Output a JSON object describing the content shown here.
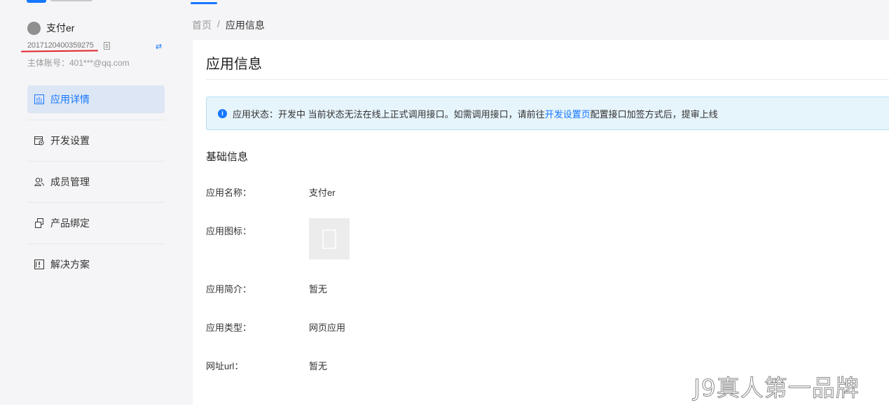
{
  "app": {
    "name": "支付er",
    "id": "2017120400359275",
    "owner": "主体账号：401***@qq.com"
  },
  "menu": [
    {
      "label": "应用详情",
      "icon": "chart-icon",
      "active": true
    },
    {
      "label": "开发设置",
      "icon": "settings-doc-icon",
      "active": false
    },
    {
      "label": "成员管理",
      "icon": "users-icon",
      "active": false
    },
    {
      "label": "产品绑定",
      "icon": "link-icon",
      "active": false
    },
    {
      "label": "解决方案",
      "icon": "solution-icon",
      "active": false
    }
  ],
  "breadcrumb": {
    "home": "首页",
    "separator": "/",
    "current": "应用信息"
  },
  "page": {
    "title": "应用信息",
    "alert": {
      "prefix": "应用状态：开发中 当前状态无法在线上正式调用接口。如需调用接口，请前往",
      "link": "开发设置页",
      "suffix": "配置接口加签方式后，提审上线"
    },
    "section_title": "基础信息",
    "fields": {
      "name": {
        "label": "应用名称：",
        "value": "支付er"
      },
      "icon": {
        "label": "应用图标："
      },
      "intro": {
        "label": "应用简介：",
        "value": "暂无"
      },
      "type": {
        "label": "应用类型：",
        "value": "网页应用"
      },
      "url": {
        "label": "网址url：",
        "value": "暂无"
      }
    }
  },
  "watermark": "J9真人第一品牌",
  "colors": {
    "accent": "#1677ff",
    "annotation_red": "#e0242a",
    "alert_bg": "#e6f4fb"
  }
}
